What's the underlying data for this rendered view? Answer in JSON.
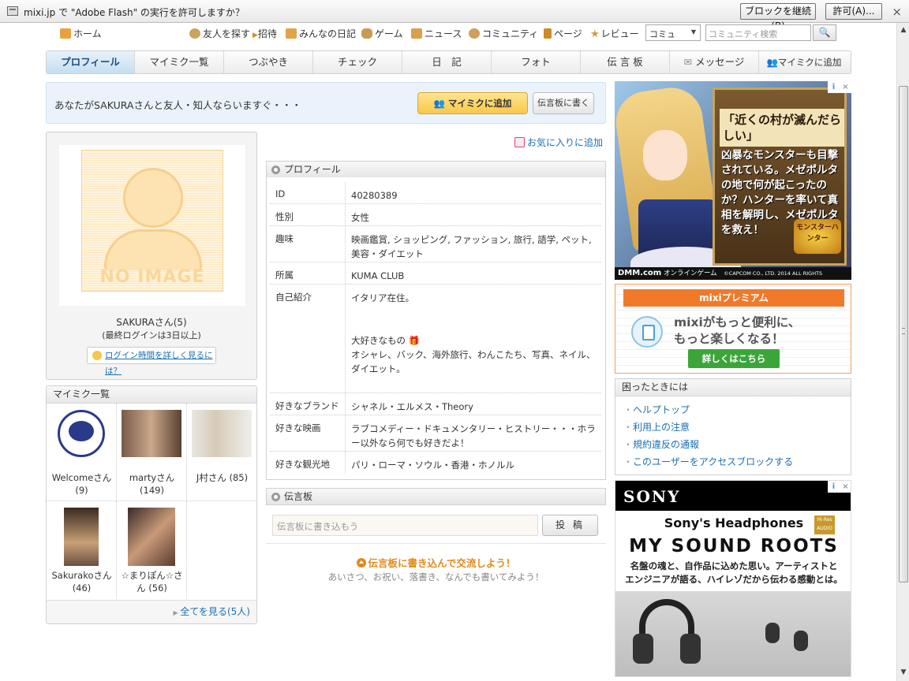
{
  "flash_bar": {
    "text": "mixi.jp で \"Adobe Flash\" の実行を許可しますか？",
    "block_label": "ブロックを継続(B)",
    "allow_label": "許可(A)...",
    "close_glyph": "×"
  },
  "topnav": {
    "items": [
      "ホーム",
      "友人を探す",
      "招待",
      "みんなの日記",
      "ゲーム",
      "ニュース",
      "コミュニティ",
      "ページ",
      "レビュー"
    ],
    "select_value": "コミュ",
    "search_placeholder": "コミュニティ検索",
    "search_button": "🔍"
  },
  "tabs": [
    "プロフィール",
    "マイミク一覧",
    "つぶやき",
    "チェック",
    "日　記",
    "フォト",
    "伝 言 板",
    "メッセージ",
    "マイミクに追加"
  ],
  "infobar": {
    "text": "あなたがSAKURAさんと友人・知人ならいますぐ・・・",
    "add_button": "マイミクに追加",
    "board_button": "伝言板に書く"
  },
  "profile_card": {
    "no_image": "NO IMAGE",
    "name": "SAKURAさん(5)",
    "last_login": "(最終ログインは3日以上)",
    "login_help": "ログイン時間を詳しく見るには？"
  },
  "friends": {
    "title": "マイミク一覧",
    "items": [
      {
        "name": "Welcomeさん (9)"
      },
      {
        "name": "martyさん (149)"
      },
      {
        "name": "J村さん (85)"
      },
      {
        "name": "Sakurakoさん (46)"
      },
      {
        "name": "☆まりぽん☆さん (56)"
      }
    ],
    "more": "全てを見る(5人)"
  },
  "favorite_link": "お気に入りに追加",
  "profile": {
    "title": "プロフィール",
    "rows": [
      {
        "key": "ID",
        "value": "40280389"
      },
      {
        "key": "性別",
        "value": "女性"
      },
      {
        "key": "趣味",
        "value": "映画鑑賞, ショッピング, ファッション, 旅行, 語学, ペット, 美容・ダイエット"
      },
      {
        "key": "所属",
        "value": "KUMA CLUB"
      },
      {
        "key": "自己紹介",
        "value_lines": [
          "イタリア在住。",
          "",
          "",
          "大好きなもの 🎁",
          "オシャレ、バック、海外旅行、わんこたち、写真、ネイル、ダイエット。"
        ]
      },
      {
        "key": "好きなブランド",
        "value": "シャネル・エルメス・Theory"
      },
      {
        "key": "好きな映画",
        "value": "ラブコメディー・ドキュメンタリー・ヒストリー・・・ホラー以外なら何でも好きだよ！"
      },
      {
        "key": "好きな観光地",
        "value": "パリ・ローマ・ソウル・香港・ホノルル"
      }
    ]
  },
  "board": {
    "title": "伝言板",
    "placeholder": "伝言板に書き込もう",
    "post_button": "投 稿",
    "cta": "伝言板に書き込んで交流しよう！",
    "sub": "あいさつ、お祝い、落書き、なんでも書いてみよう！"
  },
  "ad_game": {
    "headline": "「近くの村が滅んだらしい」",
    "body": "凶暴なモンスターも目撃されている。メゼポルタの地で何が起こったのか？ハンターを率いて真相を解明し、メゼポルタを救え！",
    "badge": "モンスターハンター",
    "footer_brand": "DMM.com",
    "footer_text": "オンラインゲーム",
    "copyright": "©CAPCOM CO., LTD. 2014 ALL RIGHTS RESERVED."
  },
  "premium": {
    "ribbon": "mixiプレミアム",
    "line1": "mixiがもっと便利に、",
    "line2": "もっと楽しくなる！",
    "button": "詳しくはこちら"
  },
  "help": {
    "title": "困ったときには",
    "links": [
      "ヘルプトップ",
      "利用上の注意",
      "規約違反の通報",
      "このユーザーをアクセスブロックする"
    ]
  },
  "ad_sony": {
    "logo": "SONY",
    "headline": "Sony's Headphones",
    "hires": "Hi-Res AUDIO",
    "roots": "MY SOUND ROOTS",
    "desc1": "名盤の魂と、自作品に込めた思い。アーティストと",
    "desc2": "エンジニアが語る、ハイレゾだから伝わる感動とは。"
  },
  "colors": {
    "accent_blue": "#1a6fb3",
    "tab_active": "#c6def1",
    "add_button": "#f8c84a",
    "premium_orange": "#f07a2a",
    "cta_orange": "#e08a1e"
  }
}
